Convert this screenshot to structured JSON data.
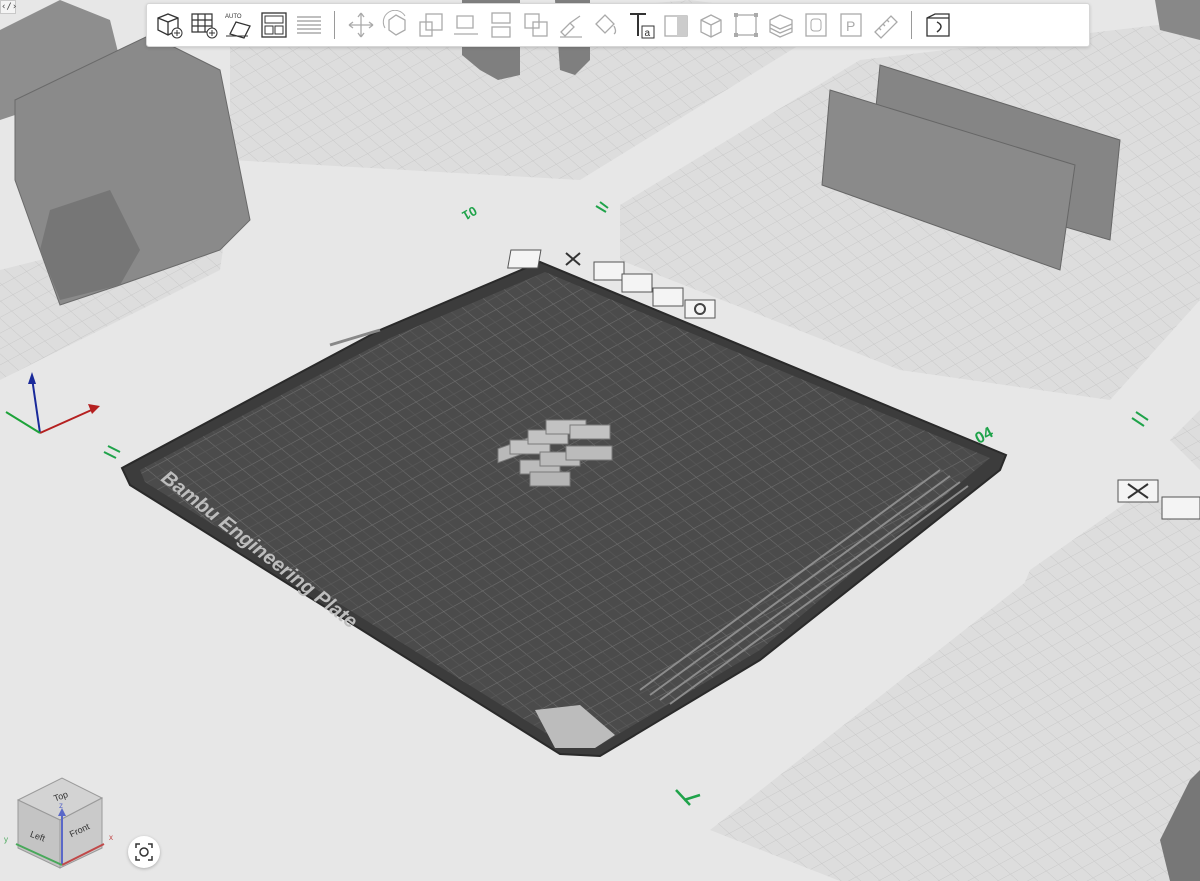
{
  "app": {
    "window_toggle": "‹/›"
  },
  "plate": {
    "name": "Bambu Engineering Plate",
    "number_current": "04",
    "number_left_top": "01",
    "icons": [
      "close-plate-icon",
      "lock-plate-icon",
      "plate-settings-icon",
      "arrange-plate-icon",
      "orient-plate-icon"
    ]
  },
  "right_plate": {
    "icons": [
      "close-plate-icon",
      "lock-plate-icon"
    ]
  },
  "view_cube": {
    "top": "Top",
    "left": "Left",
    "front": "Front",
    "axis_x": "x",
    "axis_y": "y",
    "axis_z": "z"
  },
  "toolbar": {
    "groups": [
      [
        "add-object",
        "add-plate",
        "auto-orient",
        "arrange",
        "split-layers"
      ],
      [
        "move",
        "rotate",
        "scale",
        "lay-on-face",
        "cut",
        "mesh-boolean",
        "support-paint",
        "seam-paint",
        "text",
        "emboss",
        "assembly",
        "measure",
        "fuzzy",
        "simplify",
        "fill",
        "shell",
        "paint-color",
        "ruler"
      ],
      [
        "variable-layer"
      ]
    ]
  },
  "colors": {
    "background": "#e7e7e7",
    "plate_dark": "#4a4a4a",
    "plate_grid": "#6c6c6c",
    "grid_light": "#d9d9d9",
    "model_gray": "#8a8a8a",
    "plate_number_green": "#1fa34a"
  }
}
